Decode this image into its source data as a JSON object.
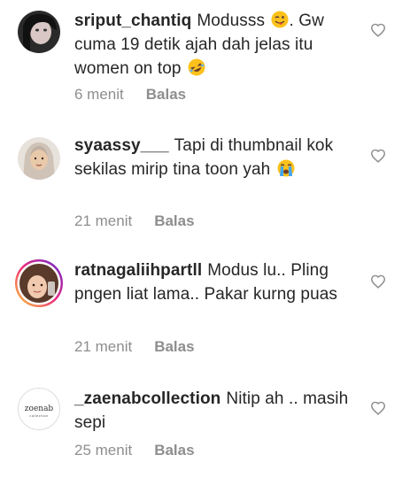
{
  "comments": [
    {
      "username": "sriput_chantiq",
      "text": "Modusss",
      "text_after": ". Gw cuma 19 detik ajah dah jelas itu women on top",
      "emojis": [
        "winking-face-with-tongue-emoji",
        "rolling-on-floor-laughing-emoji"
      ],
      "time": "6 menit",
      "reply": "Balas"
    },
    {
      "username": "syaassy___",
      "text": "Tapi di thumbnail kok sekilas mirip tina toon yah",
      "emojis": [
        "loudly-crying-face-emoji"
      ],
      "time": "21 menit",
      "reply": "Balas"
    },
    {
      "username": "ratnagaliihpartll",
      "text": "Modus lu.. Pling pngen liat lama.. Pakar kurng puas",
      "time": "21 menit",
      "reply": "Balas"
    },
    {
      "username": "_zaenabcollection",
      "text": "Nitip ah .. masih sepi",
      "time": "25 menit",
      "reply": "Balas"
    }
  ],
  "avatar_logo_text": {
    "top": "zoenab",
    "bottom": "collection"
  },
  "colors": {
    "text": "#262626",
    "meta": "#8e8e8e",
    "heart": "#8e8e8e",
    "story_ring_start": "#f9ce34",
    "story_ring_mid": "#ee2a7b",
    "story_ring_end": "#6228d7"
  },
  "icons": {
    "like": "heart-outline-icon"
  }
}
